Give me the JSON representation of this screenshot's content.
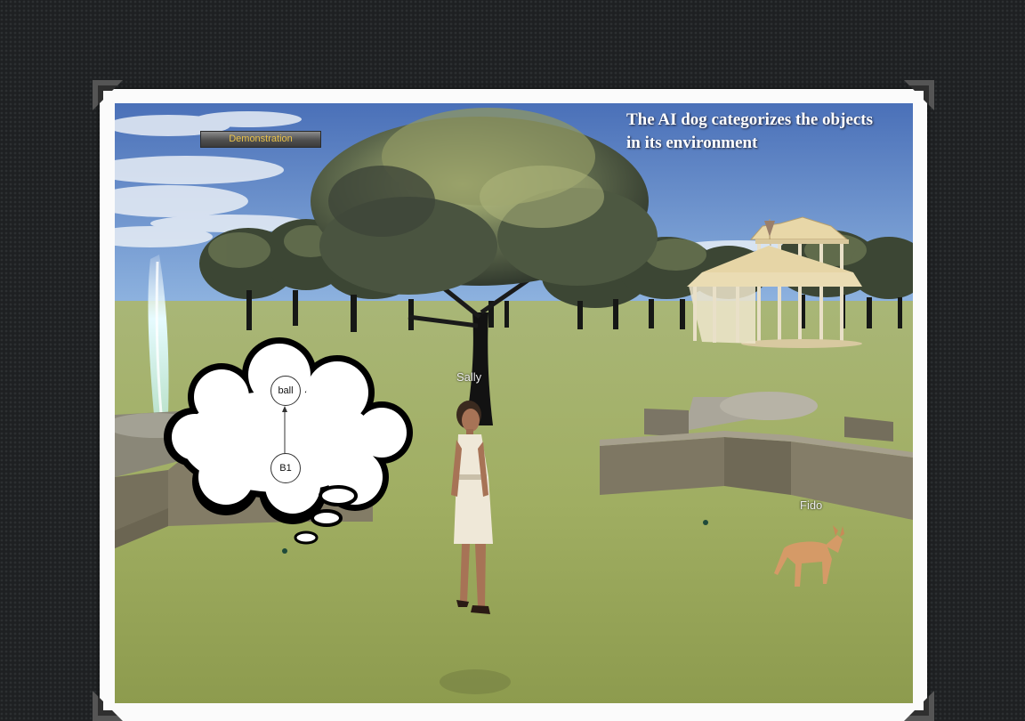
{
  "demo_button": {
    "label": "Demonstration"
  },
  "caption": {
    "line1": "The AI dog categorizes the objects",
    "line2": "in its environment"
  },
  "characters": {
    "woman_name": "Sally",
    "dog_name": "Fido"
  },
  "thought_bubble": {
    "top_node": "ball",
    "bottom_node": "B1"
  },
  "colors": {
    "sky": "#3d62a8",
    "grass": "#9aa85c",
    "frame": "#fbfbfb",
    "button_text": "#e8c14a"
  }
}
